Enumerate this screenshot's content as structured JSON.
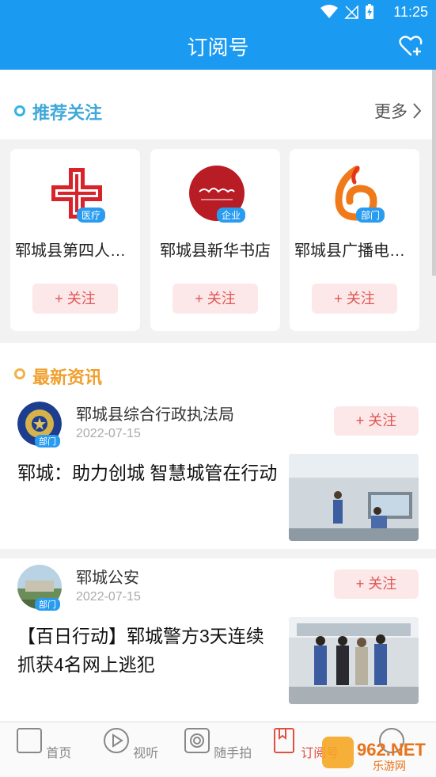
{
  "status_bar": {
    "time": "11:25"
  },
  "app_bar": {
    "title": "订阅号"
  },
  "recommend": {
    "title": "推荐关注",
    "more_label": "更多",
    "cards": [
      {
        "name": "郓城县第四人民医院",
        "tag": "医疗",
        "follow_label": "+ 关注"
      },
      {
        "name": "郓城县新华书店",
        "tag": "企业",
        "follow_label": "+ 关注"
      },
      {
        "name": "郓城县广播电视台",
        "tag": "部门",
        "follow_label": "+ 关注"
      }
    ]
  },
  "news": {
    "title": "最新资讯",
    "items": [
      {
        "source": "郓城县综合行政执法局",
        "tag": "部门",
        "date": "2022-07-15",
        "follow_label": "+ 关注",
        "headline": "郓城：助力创城 智慧城管在行动"
      },
      {
        "source": "郓城公安",
        "tag": "部门",
        "date": "2022-07-15",
        "follow_label": "+ 关注",
        "headline": "【百日行动】郓城警方3天连续抓获4名网上逃犯"
      }
    ]
  },
  "tabs": [
    {
      "label": "首页",
      "active": false
    },
    {
      "label": "视听",
      "active": false
    },
    {
      "label": "随手拍",
      "active": false
    },
    {
      "label": "订阅号",
      "active": true
    }
  ],
  "watermark": {
    "text": "962.NET",
    "sub": "乐游网"
  },
  "colors": {
    "primary": "#1a9af0",
    "recommend_accent": "#3fa8d9",
    "news_accent": "#f0a030",
    "follow_text": "#e05555",
    "follow_bg": "#fce8e8",
    "active_tab": "#e05040"
  }
}
